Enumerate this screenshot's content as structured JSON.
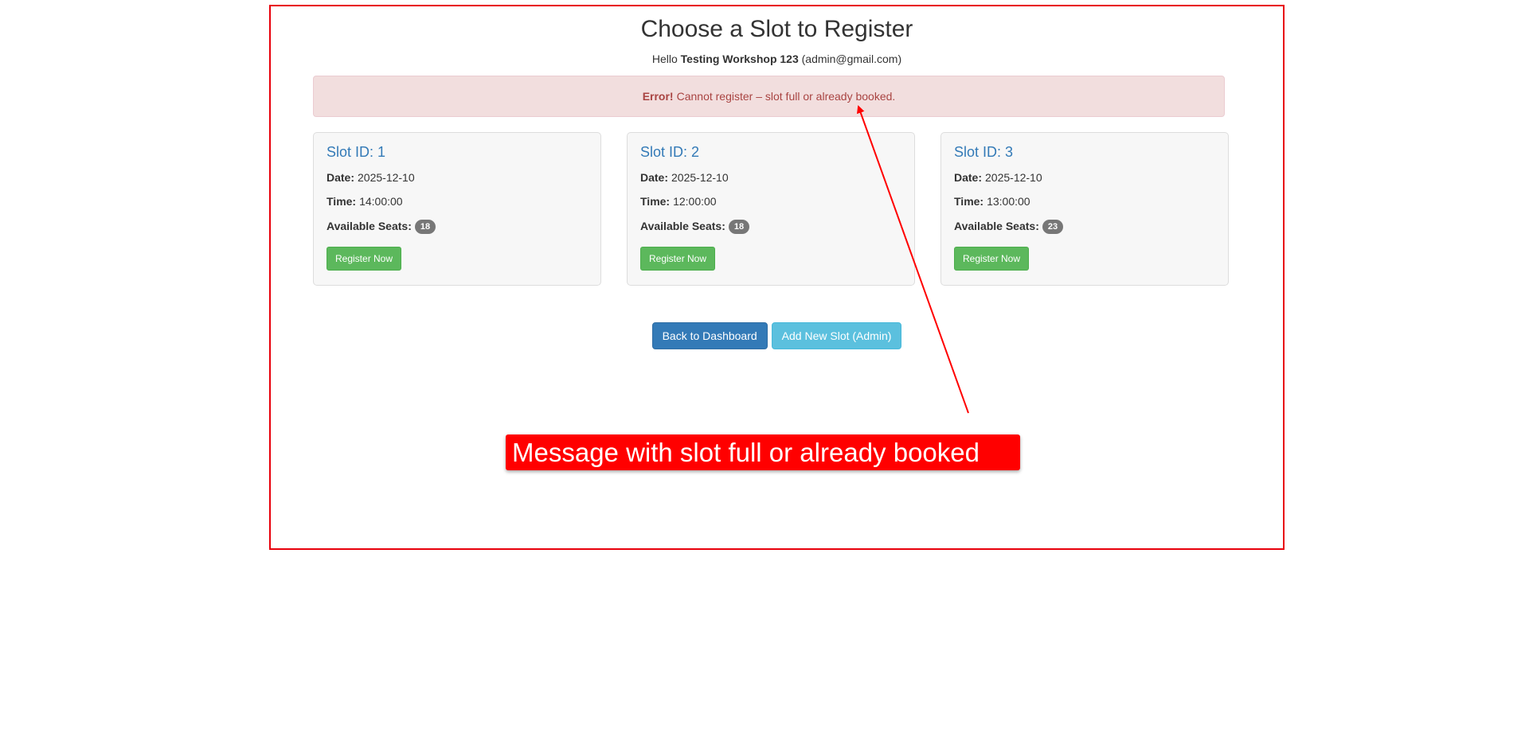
{
  "page": {
    "title": "Choose a Slot to Register",
    "greeting_prefix": "Hello",
    "user_name": "Testing Workshop 123",
    "user_email": "(admin@gmail.com)"
  },
  "alert": {
    "strong": "Error!",
    "message": "Cannot register – slot full or already booked."
  },
  "labels": {
    "date": "Date:",
    "time": "Time:",
    "seats": "Available Seats:",
    "register": "Register Now"
  },
  "slots": [
    {
      "title": "Slot ID: 1",
      "date": "2025-12-10",
      "time": "14:00:00",
      "seats": "18"
    },
    {
      "title": "Slot ID: 2",
      "date": "2025-12-10",
      "time": "12:00:00",
      "seats": "18"
    },
    {
      "title": "Slot ID: 3",
      "date": "2025-12-10",
      "time": "13:00:00",
      "seats": "23"
    }
  ],
  "actions": {
    "back": "Back to Dashboard",
    "add": "Add New Slot (Admin)"
  },
  "annotation": {
    "text": "Message with slot full or already booked",
    "color": "#ff0000"
  },
  "colors": {
    "frame": "#e8000b",
    "alert_bg": "#f2dede",
    "alert_text": "#a94442",
    "link_blue": "#337ab7",
    "success": "#5cb85c",
    "info": "#5bc0de"
  }
}
